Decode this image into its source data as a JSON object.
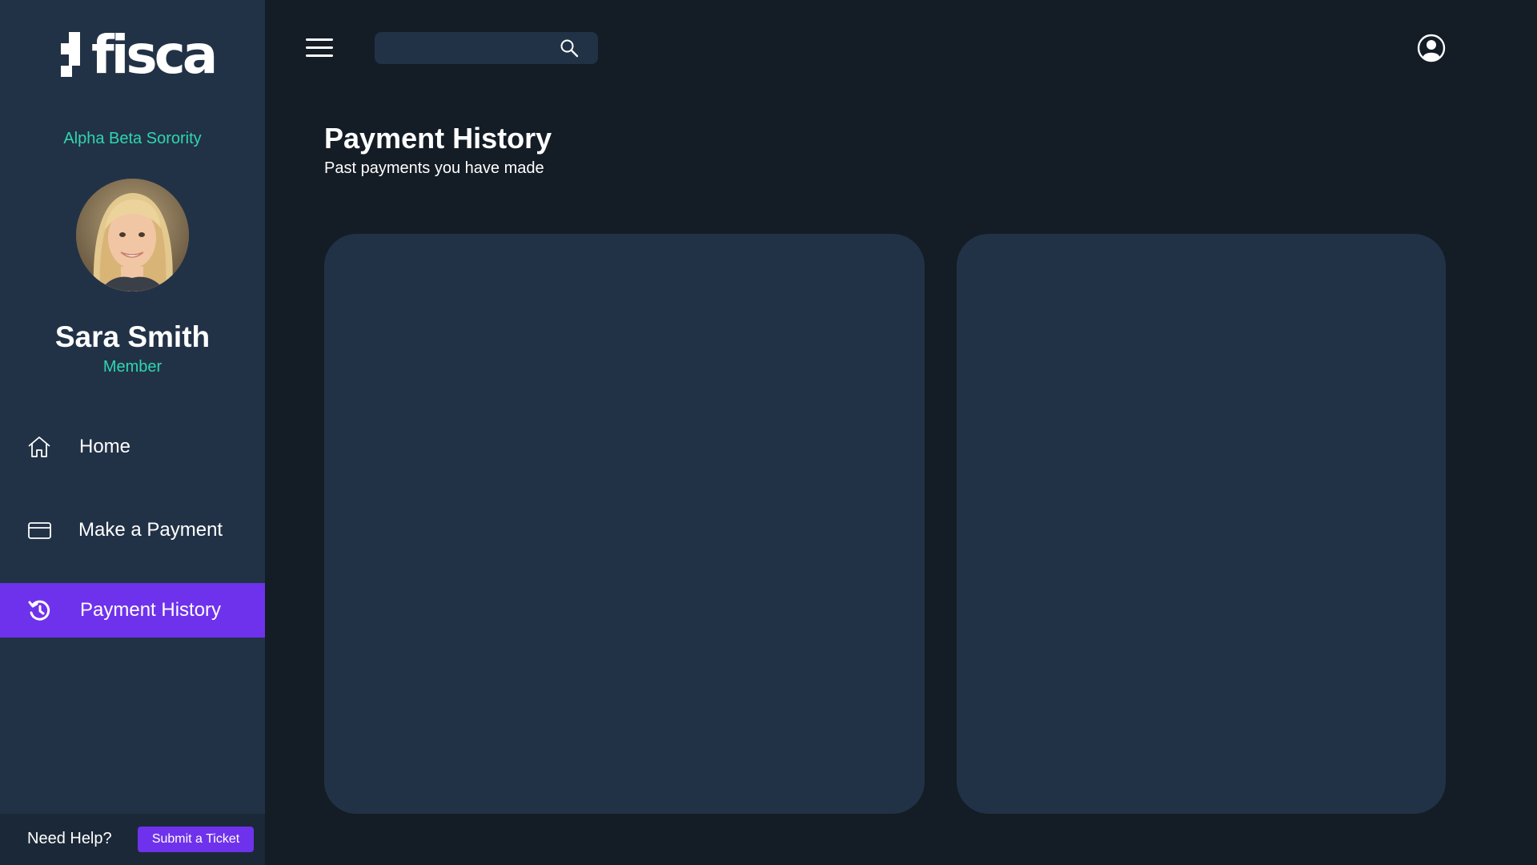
{
  "app": {
    "logo_text": "fisca",
    "organization": "Alpha Beta Sorority"
  },
  "user": {
    "name": "Sara Smith",
    "role": "Member"
  },
  "sidebar": {
    "items": [
      {
        "label": "Home",
        "icon": "home-icon",
        "active": false
      },
      {
        "label": "Make a Payment",
        "icon": "credit-card-icon",
        "active": false
      },
      {
        "label": "Payment History",
        "icon": "history-icon",
        "active": true
      }
    ],
    "help_text": "Need Help?",
    "ticket_button": "Submit a Ticket"
  },
  "header": {
    "search_placeholder": "",
    "search_value": ""
  },
  "main": {
    "title": "Payment History",
    "subtitle": "Past payments you have made"
  },
  "colors": {
    "accent": "#6f32ec",
    "teal": "#2fd6b0",
    "sidebar_bg": "#223246",
    "page_bg": "#141c25",
    "panel_bg": "#223246"
  }
}
